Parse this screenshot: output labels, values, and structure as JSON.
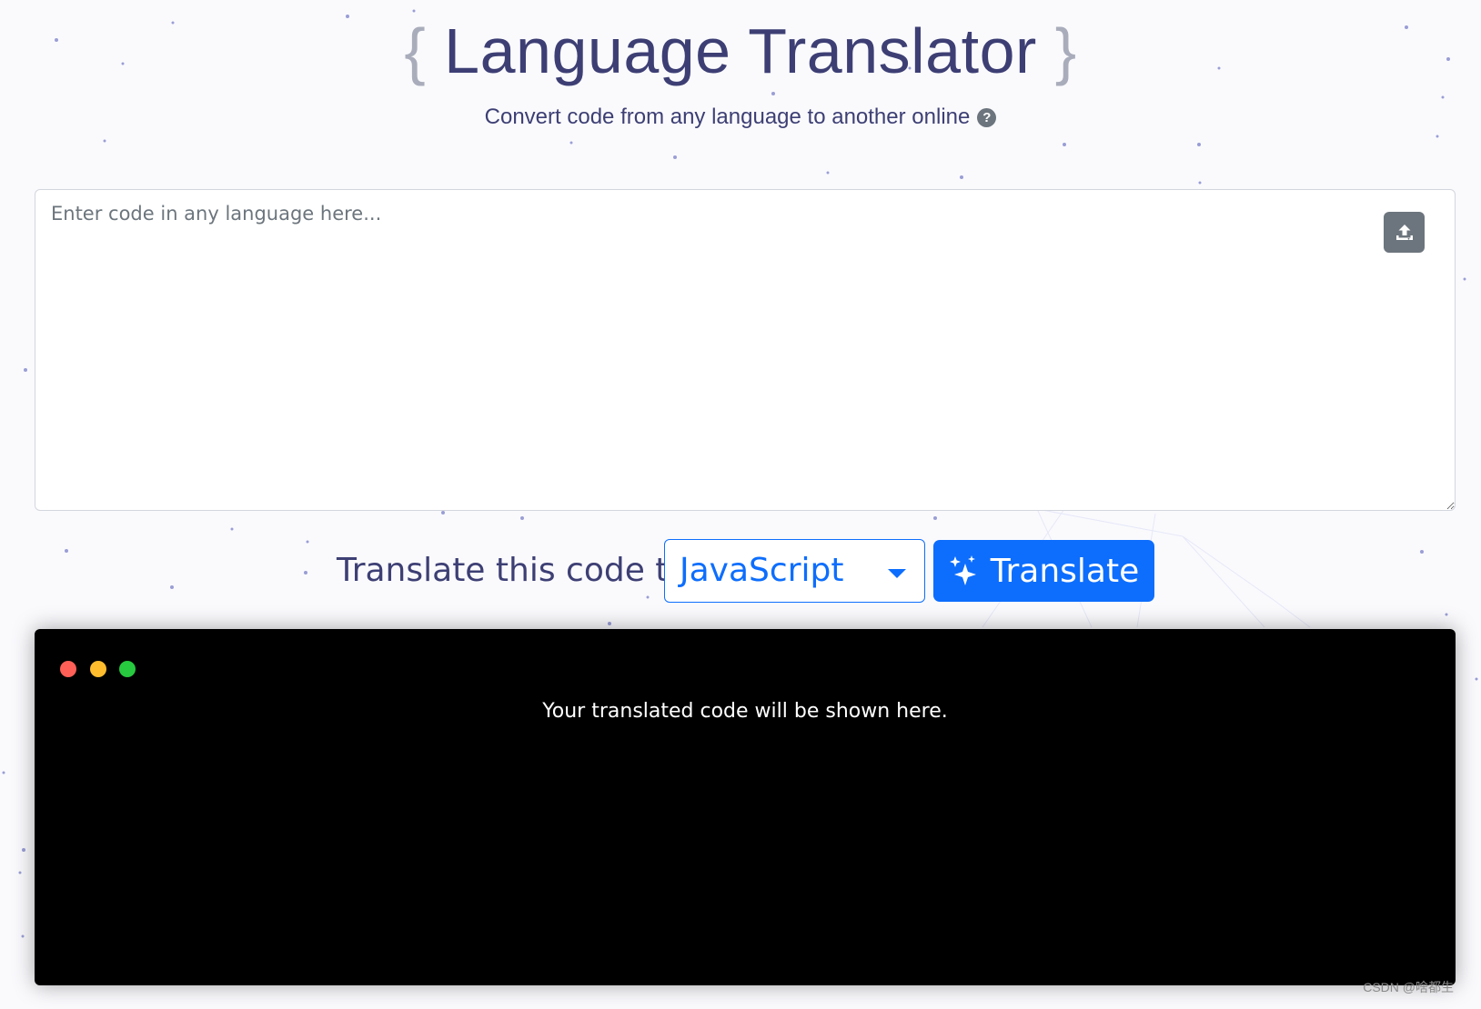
{
  "header": {
    "open_brace": "{",
    "title": "Language Translator",
    "close_brace": "}",
    "subtitle": "Convert code from any language to another online",
    "help_icon_glyph": "?"
  },
  "input": {
    "placeholder": "Enter code in any language here...",
    "value": "",
    "upload_icon": "upload-icon"
  },
  "controls": {
    "label": "Translate this code to",
    "selected_language": "JavaScript",
    "translate_button_label": "Translate",
    "translate_icon": "sparkles-icon"
  },
  "output": {
    "placeholder_text": "Your translated code will be shown here."
  },
  "watermark": "CSDN @啥都生",
  "colors": {
    "accent": "#0d6efd",
    "title": "#3d3f74",
    "output_bg": "#000000",
    "dot_red": "#ff5f56",
    "dot_yellow": "#ffbd2e",
    "dot_green": "#27c93f"
  }
}
